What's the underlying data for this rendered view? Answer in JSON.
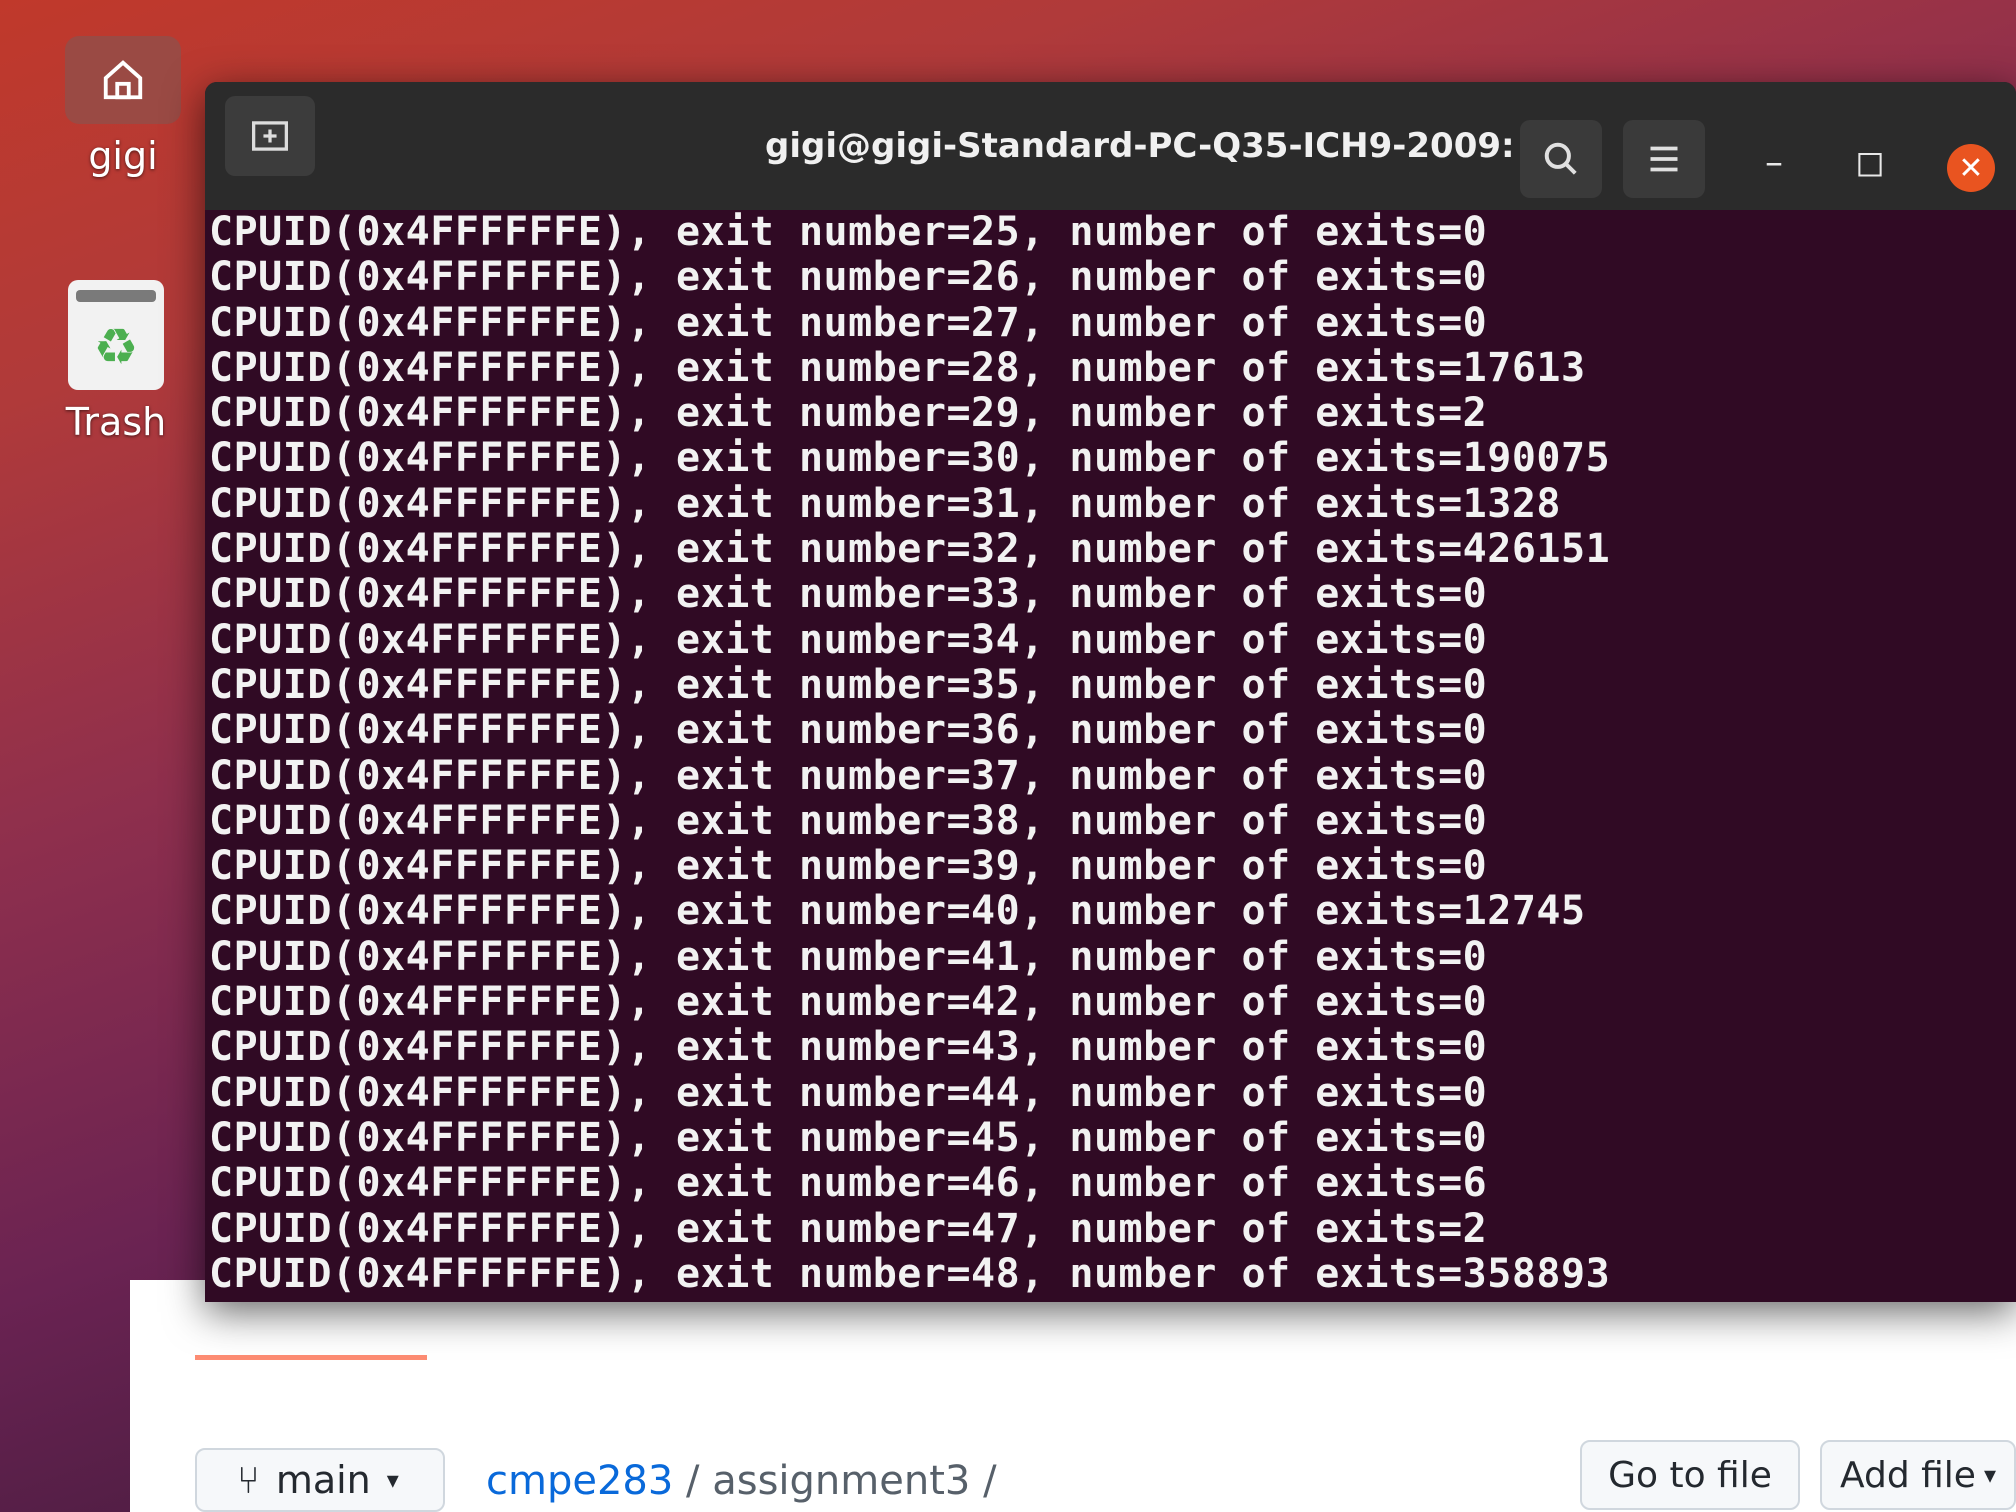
{
  "desktop": {
    "home_label": "gigi",
    "trash_label": "Trash"
  },
  "terminal": {
    "title": "gigi@gigi-Standard-PC-Q35-ICH9-2009: ~",
    "icons": {
      "new_tab": "new-tab-icon",
      "search": "search-icon",
      "menu": "hamburger-menu-icon",
      "minimize": "minimize-icon",
      "maximize": "maximize-icon",
      "close": "close-icon"
    },
    "lines": [
      "CPUID(0x4FFFFFFE), exit number=25, number of exits=0",
      "CPUID(0x4FFFFFFE), exit number=26, number of exits=0",
      "CPUID(0x4FFFFFFE), exit number=27, number of exits=0",
      "CPUID(0x4FFFFFFE), exit number=28, number of exits=17613",
      "CPUID(0x4FFFFFFE), exit number=29, number of exits=2",
      "CPUID(0x4FFFFFFE), exit number=30, number of exits=190075",
      "CPUID(0x4FFFFFFE), exit number=31, number of exits=1328",
      "CPUID(0x4FFFFFFE), exit number=32, number of exits=426151",
      "CPUID(0x4FFFFFFE), exit number=33, number of exits=0",
      "CPUID(0x4FFFFFFE), exit number=34, number of exits=0",
      "CPUID(0x4FFFFFFE), exit number=35, number of exits=0",
      "CPUID(0x4FFFFFFE), exit number=36, number of exits=0",
      "CPUID(0x4FFFFFFE), exit number=37, number of exits=0",
      "CPUID(0x4FFFFFFE), exit number=38, number of exits=0",
      "CPUID(0x4FFFFFFE), exit number=39, number of exits=0",
      "CPUID(0x4FFFFFFE), exit number=40, number of exits=12745",
      "CPUID(0x4FFFFFFE), exit number=41, number of exits=0",
      "CPUID(0x4FFFFFFE), exit number=42, number of exits=0",
      "CPUID(0x4FFFFFFE), exit number=43, number of exits=0",
      "CPUID(0x4FFFFFFE), exit number=44, number of exits=0",
      "CPUID(0x4FFFFFFE), exit number=45, number of exits=0",
      "CPUID(0x4FFFFFFE), exit number=46, number of exits=6",
      "CPUID(0x4FFFFFFE), exit number=47, number of exits=2",
      "CPUID(0x4FFFFFFE), exit number=48, number of exits=358893"
    ]
  },
  "github": {
    "branch": "main",
    "owner": "cmpe283",
    "repo": "assignment3",
    "separator": "/",
    "go_to_file": "Go to file",
    "add_file": "Add file"
  },
  "colors": {
    "terminal_bg": "#300a24",
    "titlebar_bg": "#2b2b2b",
    "close_button": "#e95420",
    "link": "#0969da",
    "tab_underline": "#fd8c73"
  }
}
